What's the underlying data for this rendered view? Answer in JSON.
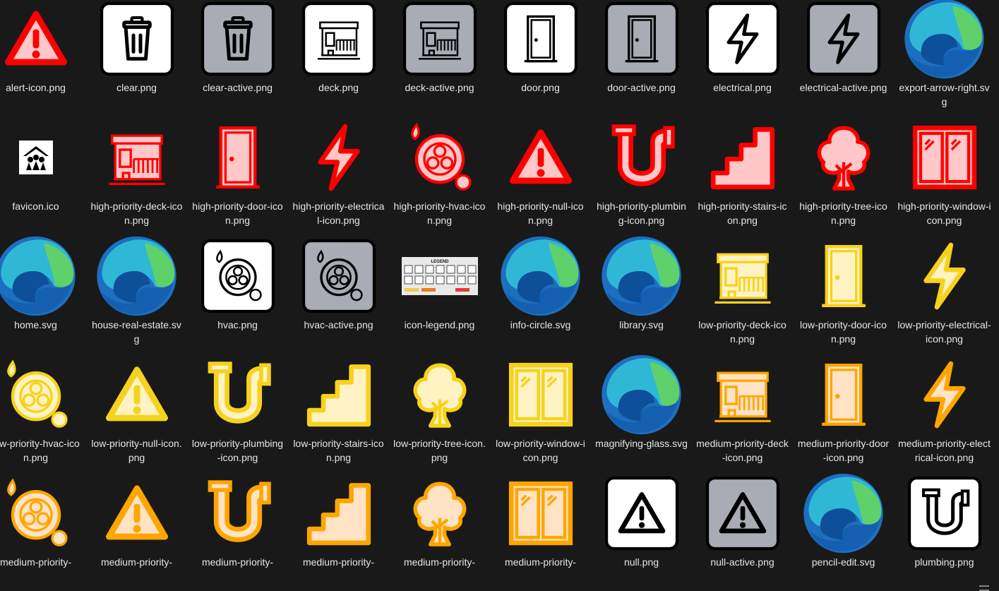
{
  "colors": {
    "background": "#191919",
    "label": "#e6e6e6",
    "high_fill": "#ffc7c7",
    "high_stroke": "#ff0000",
    "low_fill": "#fff3c4",
    "low_stroke": "#f7d21c",
    "medium_fill": "#ffe3c4",
    "medium_stroke": "#ffa500",
    "active_bg": "#a9abb5"
  },
  "files": [
    {
      "name": "alert-icon.png",
      "icon": "warning-icon",
      "style": "high"
    },
    {
      "name": "clear.png",
      "icon": "trash-icon",
      "style": "plain"
    },
    {
      "name": "clear-active.png",
      "icon": "trash-icon",
      "style": "active"
    },
    {
      "name": "deck.png",
      "icon": "deck-icon",
      "style": "plain"
    },
    {
      "name": "deck-active.png",
      "icon": "deck-icon",
      "style": "active"
    },
    {
      "name": "door.png",
      "icon": "door-icon",
      "style": "plain"
    },
    {
      "name": "door-active.png",
      "icon": "door-icon",
      "style": "active"
    },
    {
      "name": "electrical.png",
      "icon": "bolt-icon",
      "style": "plain"
    },
    {
      "name": "electrical-active.png",
      "icon": "bolt-icon",
      "style": "active"
    },
    {
      "name": "export-arrow-right.svg",
      "icon": "edge-browser-icon",
      "style": "edge"
    },
    {
      "name": "favicon.ico",
      "icon": "favicon-icon",
      "style": "favicon"
    },
    {
      "name": "high-priority-deck-icon.png",
      "icon": "deck-icon",
      "style": "high"
    },
    {
      "name": "high-priority-door-icon.png",
      "icon": "door-icon",
      "style": "high"
    },
    {
      "name": "high-priority-electrical-icon.png",
      "icon": "bolt-icon",
      "style": "high"
    },
    {
      "name": "high-priority-hvac-icon.png",
      "icon": "fan-icon",
      "style": "high"
    },
    {
      "name": "high-priority-null-icon.png",
      "icon": "warning-icon",
      "style": "high"
    },
    {
      "name": "high-priority-plumbing-icon.png",
      "icon": "pipe-icon",
      "style": "high"
    },
    {
      "name": "high-priority-stairs-icon.png",
      "icon": "stairs-icon",
      "style": "high"
    },
    {
      "name": "high-priority-tree-icon.png",
      "icon": "tree-icon",
      "style": "high"
    },
    {
      "name": "high-priority-window-icon.png",
      "icon": "window-icon",
      "style": "high"
    },
    {
      "name": "home.svg",
      "icon": "edge-browser-icon",
      "style": "edge"
    },
    {
      "name": "house-real-estate.svg",
      "icon": "edge-browser-icon",
      "style": "edge"
    },
    {
      "name": "hvac.png",
      "icon": "fan-icon",
      "style": "plain"
    },
    {
      "name": "hvac-active.png",
      "icon": "fan-icon",
      "style": "active"
    },
    {
      "name": "icon-legend.png",
      "icon": "legend-image-icon",
      "style": "legend"
    },
    {
      "name": "info-circle.svg",
      "icon": "edge-browser-icon",
      "style": "edge"
    },
    {
      "name": "library.svg",
      "icon": "edge-browser-icon",
      "style": "edge"
    },
    {
      "name": "low-priority-deck-icon.png",
      "icon": "deck-icon",
      "style": "low"
    },
    {
      "name": "low-priority-door-icon.png",
      "icon": "door-icon",
      "style": "low"
    },
    {
      "name": "low-priority-electrical-icon.png",
      "icon": "bolt-icon",
      "style": "low"
    },
    {
      "name": "low-priority-hvac-icon.png",
      "icon": "fan-icon",
      "style": "low"
    },
    {
      "name": "low-priority-null-icon.png",
      "icon": "warning-icon",
      "style": "low"
    },
    {
      "name": "low-priority-plumbing-icon.png",
      "icon": "pipe-icon",
      "style": "low"
    },
    {
      "name": "low-priority-stairs-icon.png",
      "icon": "stairs-icon",
      "style": "low"
    },
    {
      "name": "low-priority-tree-icon.png",
      "icon": "tree-icon",
      "style": "low"
    },
    {
      "name": "low-priority-window-icon.png",
      "icon": "window-icon",
      "style": "low"
    },
    {
      "name": "magnifying-glass.svg",
      "icon": "edge-browser-icon",
      "style": "edge"
    },
    {
      "name": "medium-priority-deck-icon.png",
      "icon": "deck-icon",
      "style": "medium"
    },
    {
      "name": "medium-priority-door-icon.png",
      "icon": "door-icon",
      "style": "medium"
    },
    {
      "name": "medium-priority-electrical-icon.png",
      "icon": "bolt-icon",
      "style": "medium"
    },
    {
      "name": "medium-priority-",
      "icon": "fan-icon",
      "style": "medium"
    },
    {
      "name": "medium-priority-",
      "icon": "warning-icon",
      "style": "medium"
    },
    {
      "name": "medium-priority-",
      "icon": "pipe-icon",
      "style": "medium"
    },
    {
      "name": "medium-priority-",
      "icon": "stairs-icon",
      "style": "medium"
    },
    {
      "name": "medium-priority-",
      "icon": "tree-icon",
      "style": "medium"
    },
    {
      "name": "medium-priority-",
      "icon": "window-icon",
      "style": "medium"
    },
    {
      "name": "null.png",
      "icon": "warning-icon",
      "style": "plain"
    },
    {
      "name": "null-active.png",
      "icon": "warning-icon",
      "style": "active"
    },
    {
      "name": "pencil-edit.svg",
      "icon": "edge-browser-icon",
      "style": "edge"
    },
    {
      "name": "plumbing.png",
      "icon": "pipe-icon",
      "style": "plain"
    }
  ],
  "legend": {
    "title": "LEGEND"
  }
}
